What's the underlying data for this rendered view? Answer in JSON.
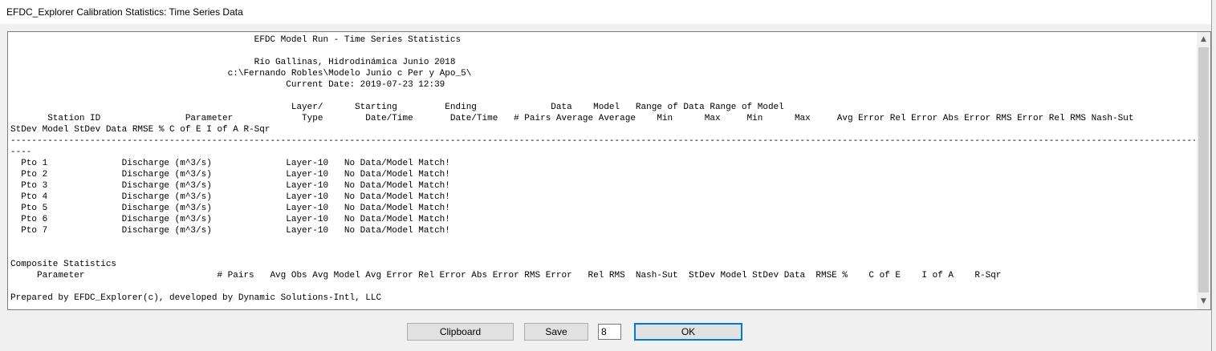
{
  "window": {
    "title": "EFDC_Explorer Calibration Statistics: Time Series Data"
  },
  "report": {
    "lines": [
      "                                              EFDC Model Run - Time Series Statistics",
      "",
      "                                              Río Gallinas, Hidrodinámica Junio 2018",
      "                                         c:\\Fernando Robles\\Modelo Junio c Per y Apo_5\\",
      "                                                    Current Date: 2019-07-23 12:39",
      "",
      "                                                     Layer/      Starting         Ending              Data    Model   Range of Data Range of Model",
      "       Station ID                Parameter             Type        Date/Time       Date/Time   # Pairs Average Average    Min      Max     Min      Max     Avg Error Rel Error Abs Error RMS Error Rel RMS Nash-Sut",
      "StDev Model StDev Data RMSE % C of E I of A R-Sqr",
      "----------------------------------------------------------------------------------------------------------------------------------------------------------------------------------------------------------------------------------",
      "----",
      "  Pto 1              Discharge (m^3/s)              Layer-10   No Data/Model Match!",
      "  Pto 2              Discharge (m^3/s)              Layer-10   No Data/Model Match!",
      "  Pto 3              Discharge (m^3/s)              Layer-10   No Data/Model Match!",
      "  Pto 4              Discharge (m^3/s)              Layer-10   No Data/Model Match!",
      "  Pto 5              Discharge (m^3/s)              Layer-10   No Data/Model Match!",
      "  Pto 6              Discharge (m^3/s)              Layer-10   No Data/Model Match!",
      "  Pto 7              Discharge (m^3/s)              Layer-10   No Data/Model Match!",
      "",
      "",
      "Composite Statistics",
      "     Parameter                         # Pairs   Avg Obs Avg Model Avg Error Rel Error Abs Error RMS Error   Rel RMS  Nash-Sut  StDev Model StDev Data  RMSE %    C of E    I of A    R-Sqr",
      "",
      "Prepared by EFDC_Explorer(c), developed by Dynamic Solutions-Intl, LLC"
    ]
  },
  "scrollbar": {
    "up_icon": "▲",
    "down_icon": "▼"
  },
  "buttons": {
    "clipboard_label": "Clipboard",
    "save_label": "Save",
    "ok_label": "OK"
  },
  "precision_input": {
    "value": "8"
  }
}
